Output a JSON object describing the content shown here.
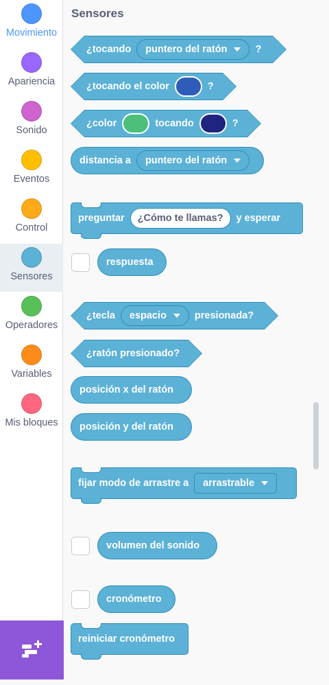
{
  "sidebar": {
    "categories": [
      {
        "label": "Movimiento",
        "color": "#4c97ff"
      },
      {
        "label": "Apariencia",
        "color": "#9966ff"
      },
      {
        "label": "Sonido",
        "color": "#cf63cf"
      },
      {
        "label": "Eventos",
        "color": "#ffbf00"
      },
      {
        "label": "Control",
        "color": "#ffab19"
      },
      {
        "label": "Sensores",
        "color": "#5cb1d6"
      },
      {
        "label": "Operadores",
        "color": "#59c059"
      },
      {
        "label": "Variables",
        "color": "#ff8c1a"
      },
      {
        "label": "Mis bloques",
        "color": "#ff6680"
      }
    ],
    "selected": "Sensores",
    "extension_icon": "add-extension-icon"
  },
  "palette": {
    "title": "Sensores",
    "blocks": {
      "touching": {
        "text": "¿tocando",
        "menu": "puntero del ratón",
        "end": "?"
      },
      "touching_color": {
        "text": "¿tocando el color",
        "color": "#2e5cb8",
        "end": "?"
      },
      "color_touching": {
        "text": "¿color",
        "color1": "#4cbf7a",
        "mid": "tocando",
        "color2": "#1f2480",
        "end": "?"
      },
      "distance": {
        "text": "distancia a",
        "menu": "puntero del ratón"
      },
      "ask": {
        "text": "preguntar",
        "input": "¿Cómo te llamas?",
        "end": "y esperar"
      },
      "answer": {
        "text": "respuesta"
      },
      "key_pressed": {
        "text": "¿tecla",
        "menu": "espacio",
        "end": "presionada?"
      },
      "mouse_down": {
        "text": "¿ratón presionado?"
      },
      "mouse_x": {
        "text": "posición x del ratón"
      },
      "mouse_y": {
        "text": "posición y del ratón"
      },
      "drag_mode": {
        "text": "fijar modo de arrastre a",
        "menu": "arrastrable"
      },
      "loudness": {
        "text": "volumen del sonido"
      },
      "timer": {
        "text": "cronómetro"
      },
      "reset_timer": {
        "text": "reiniciar cronómetro"
      }
    }
  }
}
